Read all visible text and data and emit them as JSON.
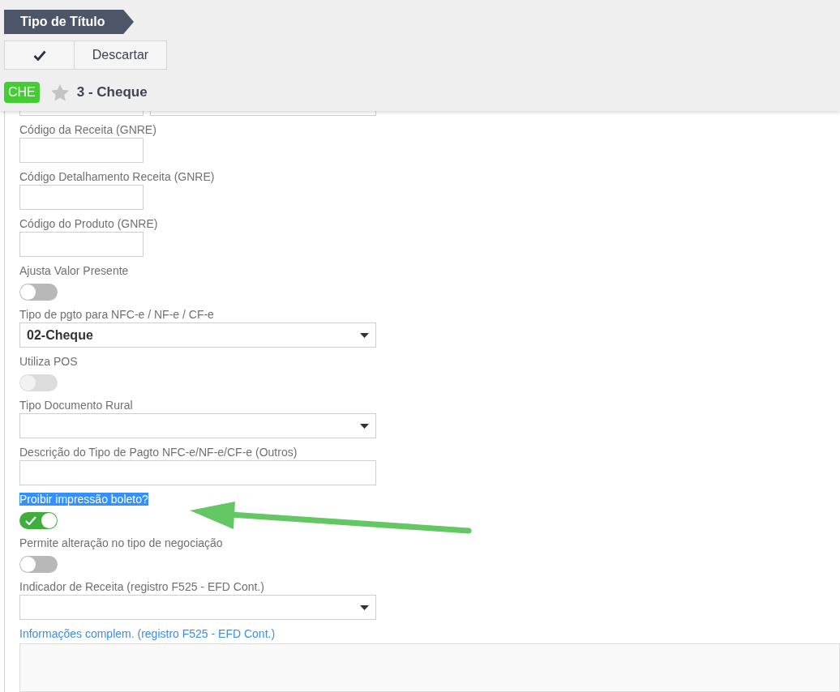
{
  "breadcrumb": "Tipo de Título",
  "toolbar": {
    "discard_label": "Descartar"
  },
  "record": {
    "badge": "CHE",
    "starred": false,
    "title": "3 - Cheque"
  },
  "fields": [
    {
      "kind": "short-text",
      "label": "Código da Receita (GNRE)",
      "highlighted": false,
      "accent": false
    },
    {
      "kind": "short-text",
      "label": "Código Detalhamento Receita (GNRE)",
      "highlighted": false,
      "accent": false
    },
    {
      "kind": "short-text",
      "label": "Código do Produto (GNRE)",
      "highlighted": false,
      "accent": false
    },
    {
      "kind": "toggle",
      "label": "Ajusta Valor Presente",
      "highlighted": false,
      "accent": false,
      "on": false,
      "disabled": false
    },
    {
      "kind": "select",
      "label": "Tipo de pgto para NFC-e / NF-e / CF-e",
      "highlighted": false,
      "accent": false,
      "value": "02-Cheque"
    },
    {
      "kind": "toggle",
      "label": "Utiliza POS",
      "highlighted": false,
      "accent": false,
      "on": false,
      "disabled": true
    },
    {
      "kind": "select",
      "label": "Tipo Documento Rural",
      "highlighted": false,
      "accent": false
    },
    {
      "kind": "text",
      "label": "Descrição do Tipo de Pagto NFC-e/NF-e/CF-e (Outros)",
      "highlighted": false,
      "accent": false
    },
    {
      "kind": "toggle",
      "label": "Proibir impressão boleto?",
      "highlighted": true,
      "accent": false,
      "on": true,
      "disabled": false
    },
    {
      "kind": "toggle",
      "label": "Permite alteração no tipo de negociação",
      "highlighted": false,
      "accent": false,
      "on": false,
      "disabled": false
    },
    {
      "kind": "select",
      "label": "Indicador de Receita (registro F525 - EFD Cont.)",
      "highlighted": false,
      "accent": false
    },
    {
      "kind": "textarea",
      "label": "Informações complem. (registro F525 - EFD Cont.)",
      "highlighted": false,
      "accent": true
    }
  ]
}
